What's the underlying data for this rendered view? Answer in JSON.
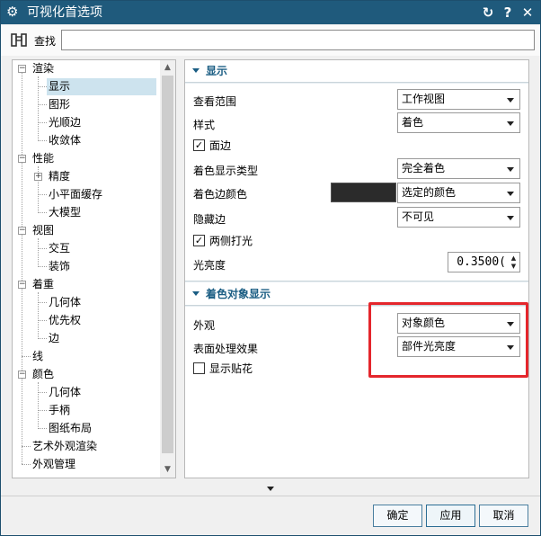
{
  "window": {
    "title": "可视化首选项",
    "icons": {
      "app": "gear-icon",
      "reset": "reset-icon",
      "help": "help-icon",
      "close": "close-icon"
    }
  },
  "search": {
    "label": "查找",
    "value": "",
    "icon": "binoculars-icon"
  },
  "tree": {
    "items": [
      {
        "label": "渲染",
        "expander": "−"
      },
      {
        "label": "显示",
        "selected": true
      },
      {
        "label": "图形"
      },
      {
        "label": "光顺边"
      },
      {
        "label": "收敛体"
      },
      {
        "label": "性能",
        "expander": "−"
      },
      {
        "label": "精度",
        "expander": "+"
      },
      {
        "label": "小平面缓存"
      },
      {
        "label": "大模型"
      },
      {
        "label": "视图",
        "expander": "−"
      },
      {
        "label": "交互"
      },
      {
        "label": "装饰"
      },
      {
        "label": "着重",
        "expander": "−"
      },
      {
        "label": "几何体"
      },
      {
        "label": "优先权"
      },
      {
        "label": "边"
      },
      {
        "label": "线"
      },
      {
        "label": "颜色",
        "expander": "−"
      },
      {
        "label": "几何体"
      },
      {
        "label": "手柄"
      },
      {
        "label": "图纸布局"
      },
      {
        "label": "艺术外观渲染"
      },
      {
        "label": "外观管理"
      }
    ]
  },
  "display_section": {
    "title": "显示",
    "view_scope_label": "查看范围",
    "view_scope_value": "工作视图",
    "style_label": "样式",
    "style_value": "着色",
    "face_edges_label": "面边",
    "face_edges_checked": "✓",
    "shaded_display_type_label": "着色显示类型",
    "shaded_display_type_value": "完全着色",
    "shaded_edge_color_label": "着色边颜色",
    "shaded_edge_color_value": "选定的颜色",
    "shaded_edge_color_swatch": "#2b2b2b",
    "hidden_edges_label": "隐藏边",
    "hidden_edges_value": "不可见",
    "two_side_light_label": "两侧打光",
    "two_side_light_checked": "✓",
    "brightness_label": "光亮度",
    "brightness_value": "0.3500("
  },
  "shaded_object_section": {
    "title": "着色对象显示",
    "appearance_label": "外观",
    "appearance_value": "对象颜色",
    "surface_effect_label": "表面处理效果",
    "surface_effect_value": "部件光亮度",
    "show_decal_label": "显示贴花",
    "show_decal_checked": ""
  },
  "buttons": {
    "ok": "确定",
    "apply": "应用",
    "cancel": "取消"
  },
  "colors": {
    "titlebar": "#1f5a7c",
    "section_title": "#1a5d83",
    "highlight": "#e4262c",
    "selected": "#cde3ee"
  }
}
